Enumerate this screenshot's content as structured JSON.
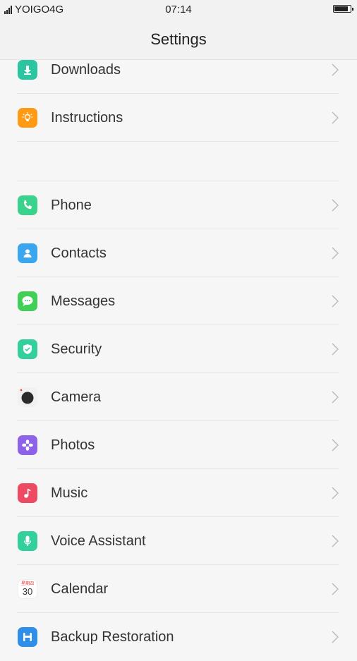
{
  "status_bar": {
    "carrier": "YOIGO4G",
    "time": "07:14",
    "battery_level_pct": 88
  },
  "header": {
    "title": "Settings"
  },
  "colors": {
    "downloads": "#2cc5a2",
    "instructions": "#ff9a15",
    "phone": "#3ad38e",
    "contacts": "#3aa6f0",
    "messages": "#42cf58",
    "security": "#33cf9c",
    "camera": "#f1f1f1",
    "photos": "#8e62e8",
    "music": "#ef4a63",
    "voice_assistant": "#33cf9c",
    "calendar": "#ffffff",
    "backup": "#2f8ee8"
  },
  "settings_items": [
    {
      "label": "Downloads",
      "icon": "download-icon"
    },
    {
      "label": "Instructions",
      "icon": "lightbulb-icon"
    },
    {
      "label": "Phone",
      "icon": "phone-icon"
    },
    {
      "label": "Contacts",
      "icon": "contact-icon"
    },
    {
      "label": "Messages",
      "icon": "message-icon"
    },
    {
      "label": "Security",
      "icon": "shield-icon"
    },
    {
      "label": "Camera",
      "icon": "camera-icon"
    },
    {
      "label": "Photos",
      "icon": "flower-icon"
    },
    {
      "label": "Music",
      "icon": "music-note-icon"
    },
    {
      "label": "Voice Assistant",
      "icon": "microphone-icon"
    },
    {
      "label": "Calendar",
      "icon": "calendar-icon",
      "icon_text_top": "星期四",
      "icon_text_day": "30"
    },
    {
      "label": "Backup Restoration",
      "icon": "floppy-disk-icon"
    }
  ]
}
